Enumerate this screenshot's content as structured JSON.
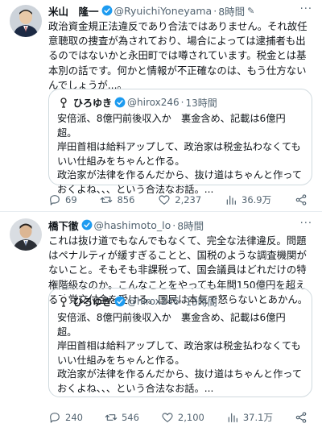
{
  "colors": {
    "verified": "#1d9bf0",
    "muted": "#536471",
    "border": "#cfd9de"
  },
  "tweets": [
    {
      "name": "米山　隆一",
      "handle": "@RyuichiYoneyama",
      "dot": "·",
      "time": "8時間",
      "text": "政治資金規正法違反であり合法ではありません。それ故任意聴取の捜査が為されており、場合によっては逮捕者も出るのではないかと永田町では噂されています。税金とは基本別の話です。何かと情報が不正確なのは、もう仕方ないんでしょうが...。",
      "quote": {
        "name": "ひろゆき",
        "handle": "@hirox246",
        "dot": "·",
        "time": "13時間",
        "text": "安倍派、8億円前後収入か　裏金含め、記載は6億円超。\n岸田首相は給料アップして、政治家は税金払わなくてもいい仕組みをちゃんと作る。\n政治家が法律を作るんだから、抜け道はちゃんと作っておくよね、、、という合法なお話。..."
      },
      "stats": {
        "replies": "69",
        "retweets": "856",
        "likes": "2,237",
        "views": "36.9万"
      }
    },
    {
      "name": "橋下徹",
      "handle": "@hashimoto_lo",
      "dot": "·",
      "time": "8時間",
      "text": "これは抜け道でもなんでもなくて、完全な法律違反。問題はペナルティが緩すぎることと、国税のような調査機関がないこと。そもそも非課税って、国会議員はどれだけの特権階級なのか。こんなことをやっても年間150億円を超える政党交付金を受ける。国民は本気で怒らないとあかん。",
      "quote": {
        "name": "ひろゆき",
        "handle": "@hirox246",
        "dot": "·",
        "time": "13時間",
        "text": "安倍派、8億円前後収入か　裏金含め、記載は6億円超。\n岸田首相は給料アップして、政治家は税金払わなくてもいい仕組みをちゃんと作る。\n政治家が法律を作るんだから、抜け道はちゃんと作っておくよね、、、という合法なお話。..."
      },
      "stats": {
        "replies": "240",
        "retweets": "546",
        "likes": "2,100",
        "views": "37.1万"
      }
    }
  ]
}
